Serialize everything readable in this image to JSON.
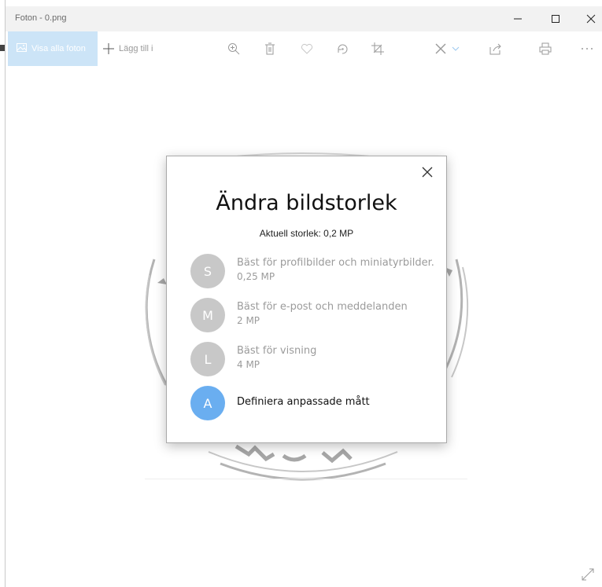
{
  "window": {
    "title": "Foton - 0.png",
    "controls": [
      "minimize-icon",
      "maximize-icon",
      "close-icon"
    ]
  },
  "toolbar": {
    "view_all_label": "Visa alla foton",
    "add_to_label": "Lägg till i",
    "icons": [
      "zoom-in-icon",
      "delete-icon",
      "favorite-icon",
      "rotate-icon",
      "crop-icon",
      "edit-icon",
      "share-icon",
      "print-icon",
      "more-icon"
    ]
  },
  "dialog": {
    "title": "Ändra bildstorlek",
    "current_size": "Aktuell storlek: 0,2 MP",
    "options": [
      {
        "letter": "S",
        "line1": "Bäst för profilbilder och miniatyrbilder.",
        "line2": "0,25 MP"
      },
      {
        "letter": "M",
        "line1": "Bäst för e-post och meddelanden",
        "line2": "2 MP"
      },
      {
        "letter": "L",
        "line1": "Bäst för visning",
        "line2": "4 MP"
      },
      {
        "letter": "A",
        "line1": "Definiera anpassade mått"
      }
    ]
  },
  "colors": {
    "accent": "#6aaef0",
    "view_all_bg": "#cce4f7",
    "option_gray": "#c8c8c8"
  }
}
